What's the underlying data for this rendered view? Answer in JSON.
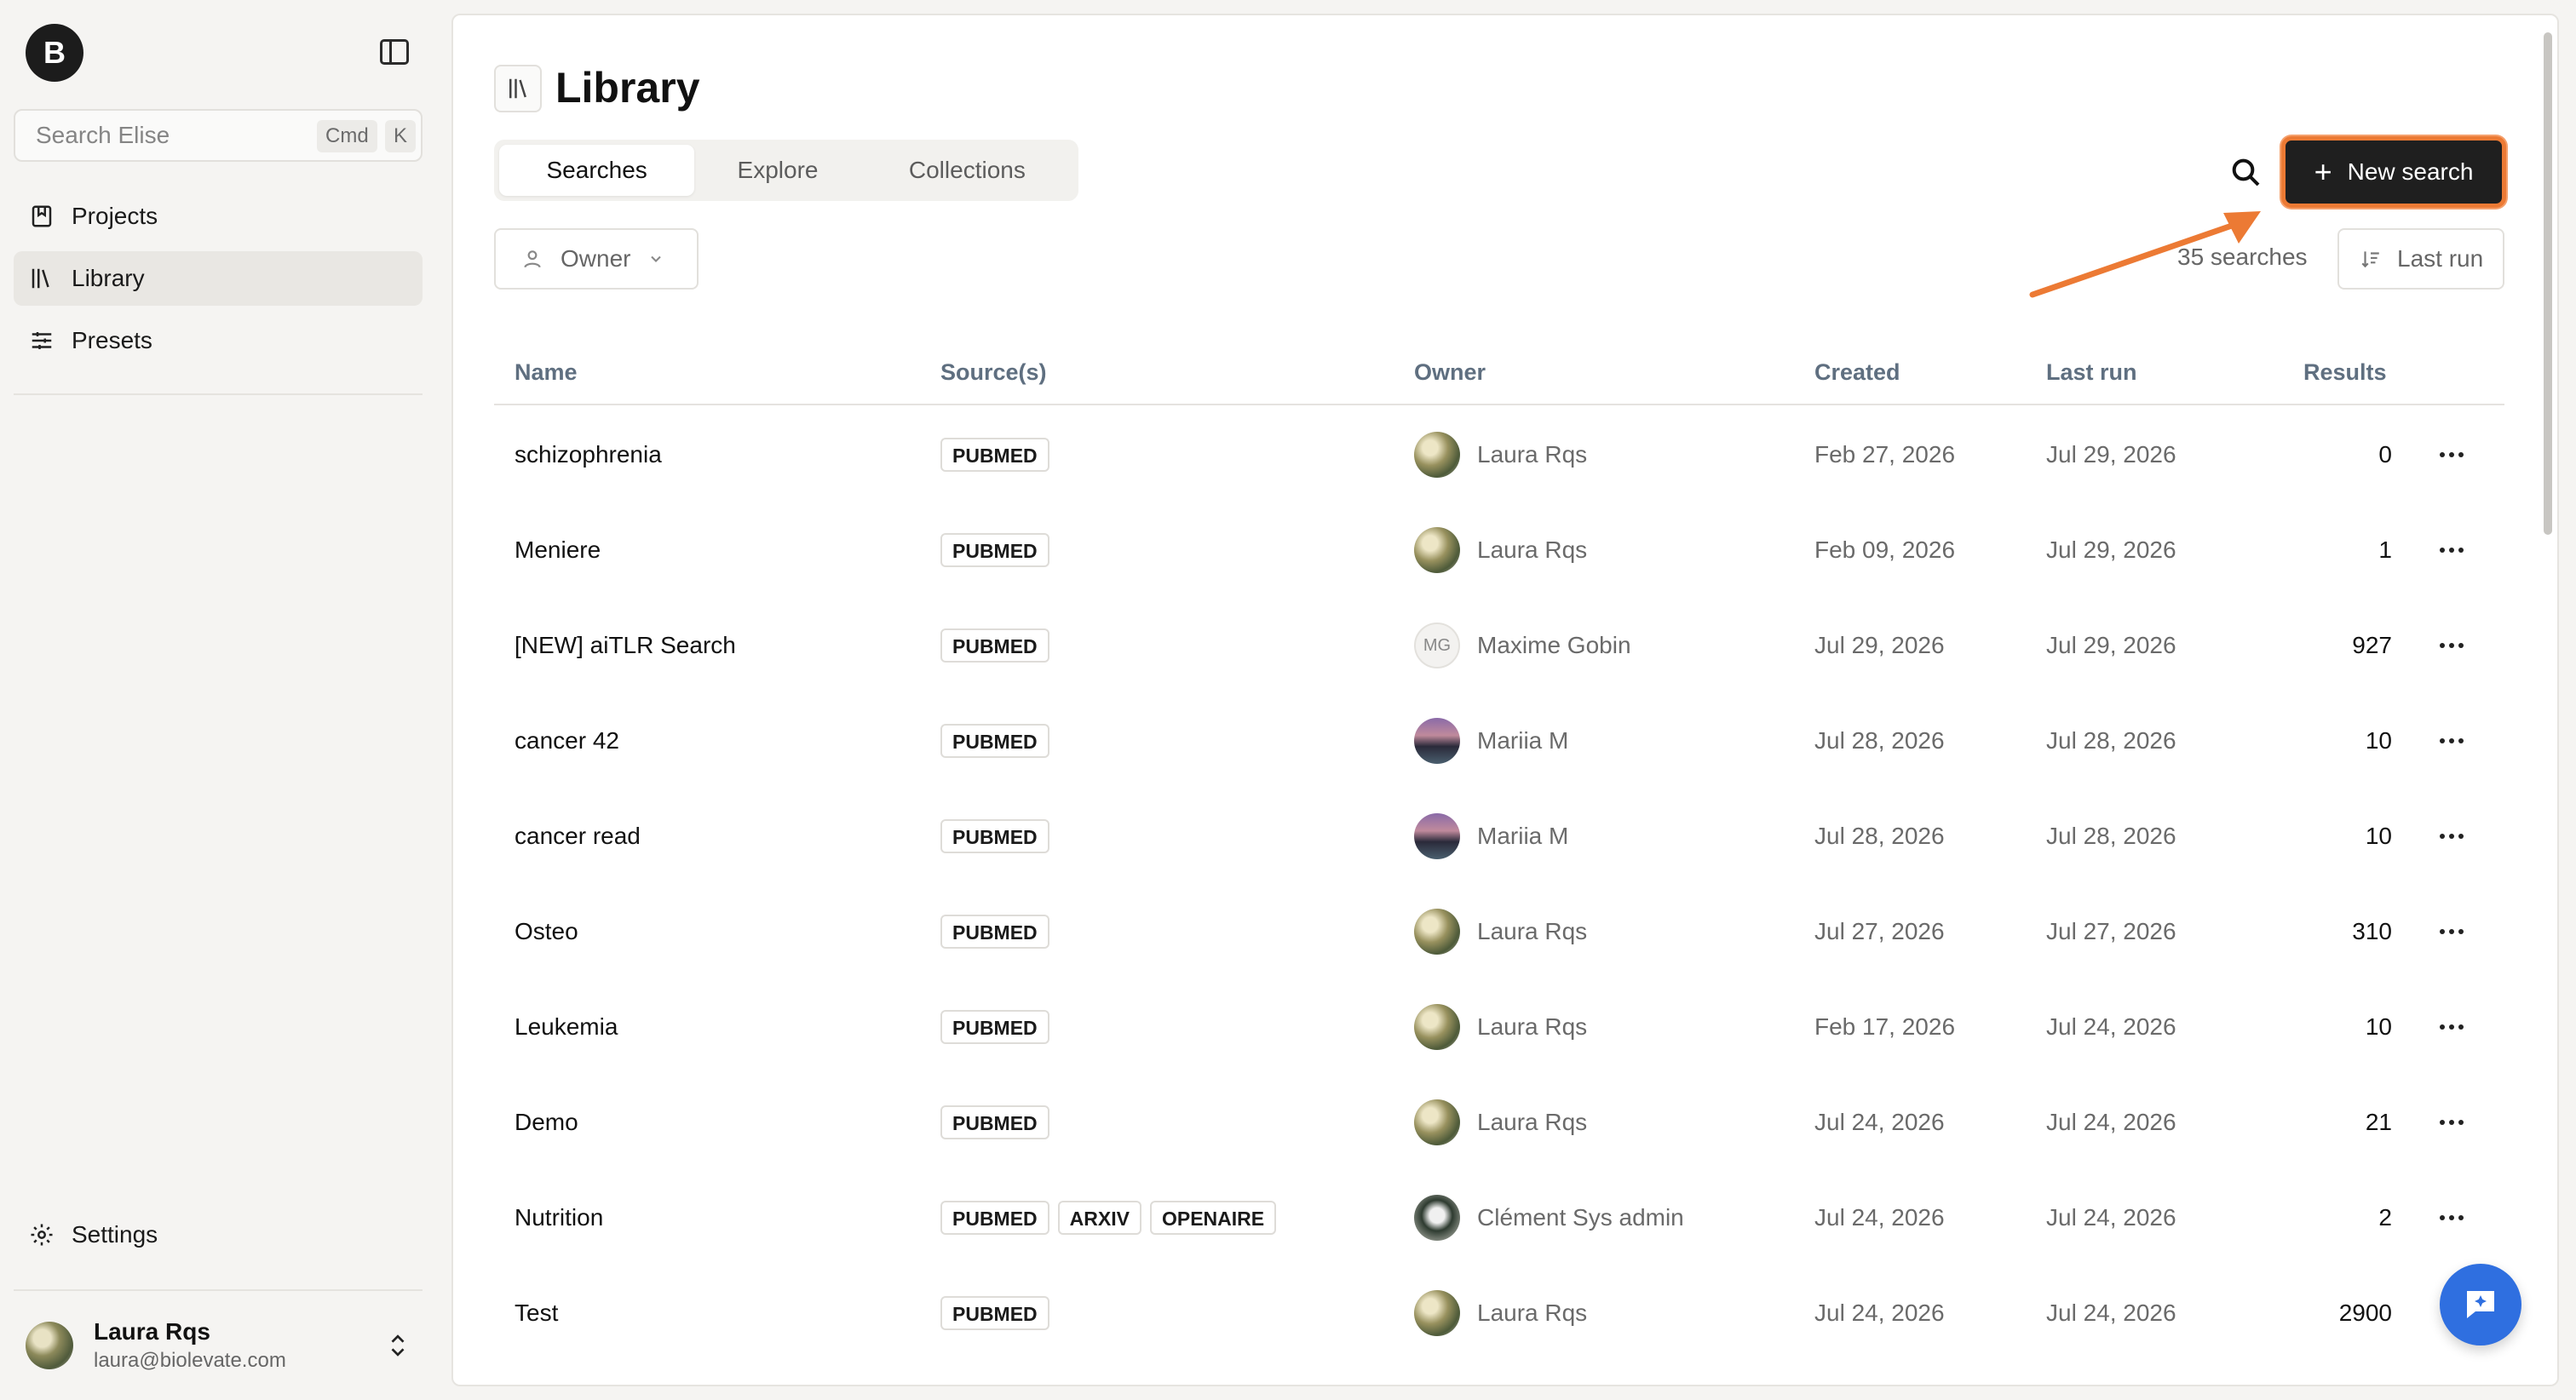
{
  "app": {
    "logo_letter": "B"
  },
  "sidebar": {
    "search_placeholder": "Search Elise",
    "shortcut_cmd": "Cmd",
    "shortcut_key": "K",
    "items": [
      {
        "label": "Projects",
        "icon": "bookmark-book-icon"
      },
      {
        "label": "Library",
        "icon": "library-icon",
        "active": true
      },
      {
        "label": "Presets",
        "icon": "sliders-icon"
      }
    ],
    "settings_label": "Settings",
    "user": {
      "name": "Laura Rqs",
      "email": "laura@biolevate.com"
    }
  },
  "page": {
    "title": "Library",
    "tabs": [
      {
        "label": "Searches",
        "active": true
      },
      {
        "label": "Explore"
      },
      {
        "label": "Collections"
      }
    ],
    "new_search_label": "New search",
    "owner_filter_label": "Owner",
    "search_count": "35 searches",
    "sort_label": "Last run",
    "highlight_color": "#ec7a34",
    "accent_color": "#2f6fe0"
  },
  "table": {
    "headers": {
      "name": "Name",
      "sources": "Source(s)",
      "owner": "Owner",
      "created": "Created",
      "last_run": "Last run",
      "results": "Results"
    },
    "rows": [
      {
        "name": "schizophrenia",
        "sources": [
          "PUBMED"
        ],
        "owner": "Laura Rqs",
        "owner_initials": "",
        "created": "Feb 27, 2026",
        "last_run": "Jul 29, 2026",
        "results": "0"
      },
      {
        "name": "Meniere",
        "sources": [
          "PUBMED"
        ],
        "owner": "Laura Rqs",
        "owner_initials": "",
        "created": "Feb 09, 2026",
        "last_run": "Jul 29, 2026",
        "results": "1"
      },
      {
        "name": "[NEW] aiTLR Search",
        "sources": [
          "PUBMED"
        ],
        "owner": "Maxime Gobin",
        "owner_initials": "MG",
        "created": "Jul 29, 2026",
        "last_run": "Jul 29, 2026",
        "results": "927"
      },
      {
        "name": "cancer 42",
        "sources": [
          "PUBMED"
        ],
        "owner": "Mariia M",
        "owner_initials": "",
        "created": "Jul 28, 2026",
        "last_run": "Jul 28, 2026",
        "results": "10"
      },
      {
        "name": "cancer read",
        "sources": [
          "PUBMED"
        ],
        "owner": "Mariia M",
        "owner_initials": "",
        "created": "Jul 28, 2026",
        "last_run": "Jul 28, 2026",
        "results": "10"
      },
      {
        "name": "Osteo",
        "sources": [
          "PUBMED"
        ],
        "owner": "Laura Rqs",
        "owner_initials": "",
        "created": "Jul 27, 2026",
        "last_run": "Jul 27, 2026",
        "results": "310"
      },
      {
        "name": "Leukemia",
        "sources": [
          "PUBMED"
        ],
        "owner": "Laura Rqs",
        "owner_initials": "",
        "created": "Feb 17, 2026",
        "last_run": "Jul 24, 2026",
        "results": "10"
      },
      {
        "name": "Demo",
        "sources": [
          "PUBMED"
        ],
        "owner": "Laura Rqs",
        "owner_initials": "",
        "created": "Jul 24, 2026",
        "last_run": "Jul 24, 2026",
        "results": "21"
      },
      {
        "name": "Nutrition",
        "sources": [
          "PUBMED",
          "ARXIV",
          "OPENAIRE"
        ],
        "owner": "Clément Sys admin",
        "owner_initials": "",
        "created": "Jul 24, 2026",
        "last_run": "Jul 24, 2026",
        "results": "2"
      },
      {
        "name": "Test",
        "sources": [
          "PUBMED"
        ],
        "owner": "Laura Rqs",
        "owner_initials": "",
        "created": "Jul 24, 2026",
        "last_run": "Jul 24, 2026",
        "results": "2900"
      }
    ]
  }
}
